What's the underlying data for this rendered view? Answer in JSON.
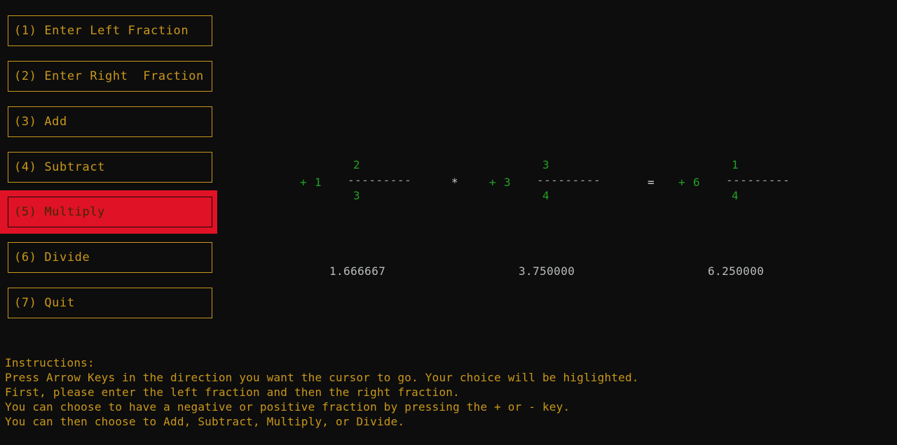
{
  "app": {
    "background_color": "#0d0d0d",
    "accent_gold": "#c9971a",
    "highlight_red": "#e01226",
    "fraction_green": "#22a022",
    "divider_grey": "#9aa0a0"
  },
  "menu": {
    "items": [
      {
        "label": "(1) Enter Left Fraction",
        "selected": false
      },
      {
        "label": "(2) Enter Right  Fraction",
        "selected": false
      },
      {
        "label": "(3) Add",
        "selected": false
      },
      {
        "label": "(4) Subtract",
        "selected": false
      },
      {
        "label": "(5) Multiply",
        "selected": true
      },
      {
        "label": "(6) Divide",
        "selected": false
      },
      {
        "label": "(7) Quit",
        "selected": false
      }
    ]
  },
  "expression": {
    "left": {
      "sign": "+",
      "whole": "1",
      "numerator": "2",
      "denominator": "3",
      "bar": "---------",
      "decimal": "1.666667"
    },
    "operator": "*",
    "right": {
      "sign": "+",
      "whole": "3",
      "numerator": "3",
      "denominator": "4",
      "bar": "---------",
      "decimal": "3.750000"
    },
    "equals": "=",
    "result": {
      "sign": "+",
      "whole": "6",
      "numerator": "1",
      "denominator": "4",
      "bar": "---------",
      "decimal": "6.250000"
    }
  },
  "instructions": {
    "heading": "Instructions:",
    "lines": [
      "Press Arrow Keys in the direction you want the cursor to go. Your choice will be higlighted.",
      "First, please enter the left fraction and then the right fraction.",
      "You can choose to have a negative or positive fraction by pressing the + or - key.",
      "You can then choose to Add, Subtract, Multiply, or Divide."
    ]
  }
}
